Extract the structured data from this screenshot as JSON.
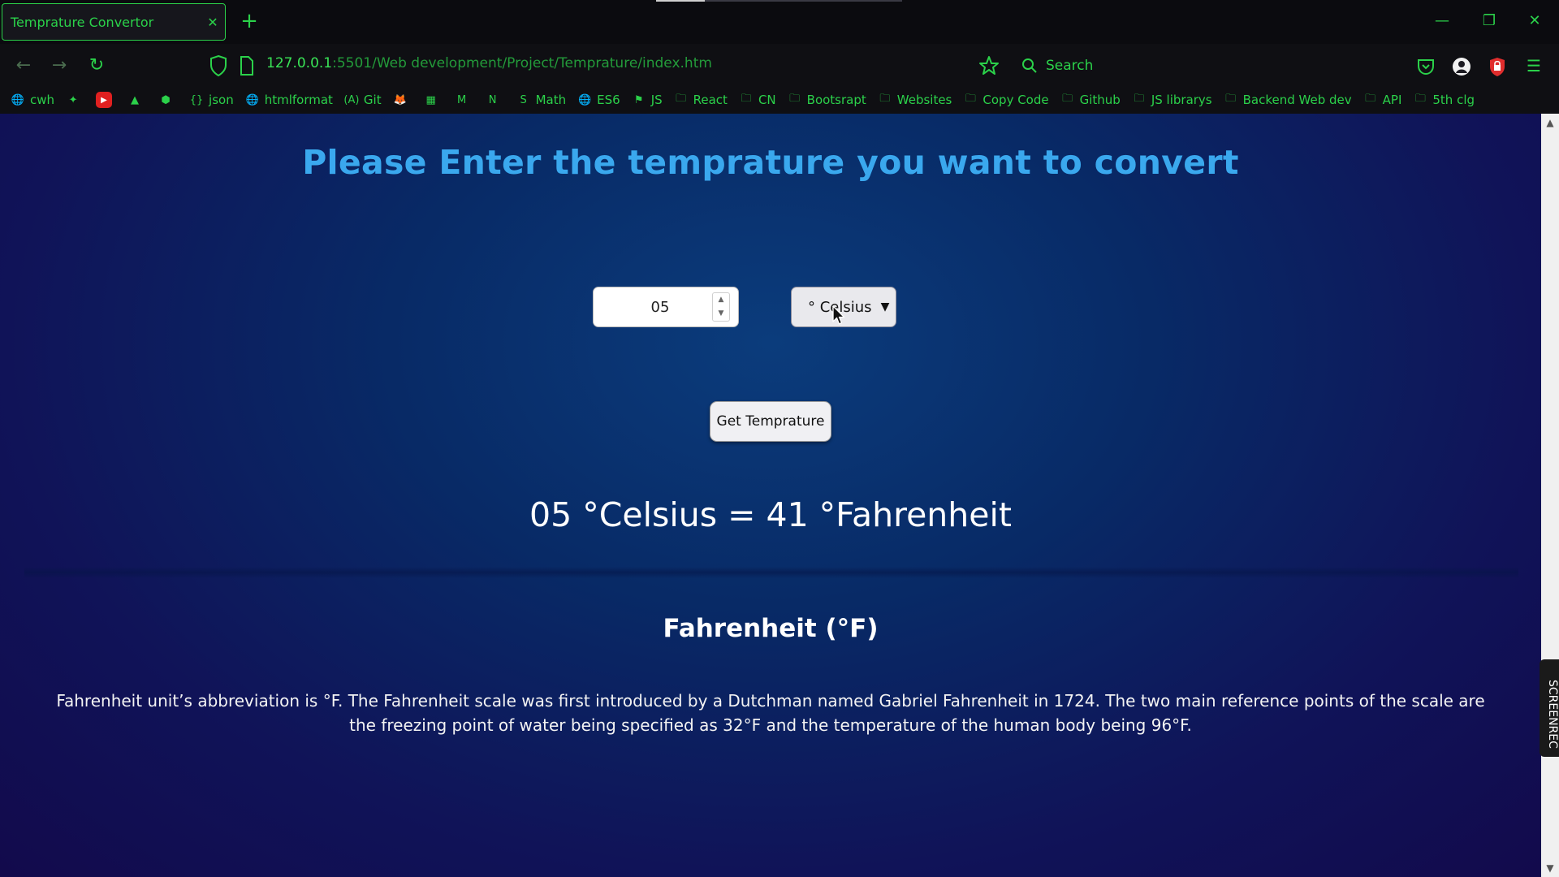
{
  "browser": {
    "tab_title": "Temprature Convertor",
    "tab_close": "✕",
    "new_tab": "+",
    "url_host": "127.0.0.1",
    "url_rest": ":5501/Web development/Project/Temprature/index.htm",
    "search_label": "Search",
    "window_controls": {
      "minimize": "—",
      "restore": "❐",
      "close": "✕"
    },
    "nav": {
      "back": "←",
      "forward": "→",
      "reload": "↻"
    },
    "bookmarks": [
      {
        "label": "cwh",
        "icon": "globe-icon"
      },
      {
        "label": "",
        "icon": "figma-icon"
      },
      {
        "label": "",
        "icon": "youtube-icon"
      },
      {
        "label": "",
        "icon": "drive-icon"
      },
      {
        "label": "",
        "icon": "hex-icon"
      },
      {
        "label": "json",
        "icon": "json-icon"
      },
      {
        "label": "htmlformat",
        "icon": "globe-icon"
      },
      {
        "label": "Git",
        "icon": "git-icon"
      },
      {
        "label": "",
        "icon": "fox-icon"
      },
      {
        "label": "",
        "icon": "grid-icon"
      },
      {
        "label": "",
        "icon": "mui-icon"
      },
      {
        "label": "",
        "icon": "notion-icon"
      },
      {
        "label": "Math",
        "icon": "s-icon"
      },
      {
        "label": "ES6",
        "icon": "globe-icon"
      },
      {
        "label": "JS",
        "icon": "js-icon"
      },
      {
        "label": "React",
        "icon": "folder-icon"
      },
      {
        "label": "CN",
        "icon": "folder-icon"
      },
      {
        "label": "Bootsrapt",
        "icon": "folder-icon"
      },
      {
        "label": "Websites",
        "icon": "folder-icon"
      },
      {
        "label": "Copy Code",
        "icon": "folder-icon"
      },
      {
        "label": "Github",
        "icon": "folder-icon"
      },
      {
        "label": "JS librarys",
        "icon": "folder-icon"
      },
      {
        "label": "Backend Web dev",
        "icon": "folder-icon"
      },
      {
        "label": "API",
        "icon": "folder-icon"
      },
      {
        "label": "5th clg",
        "icon": "folder-icon"
      }
    ]
  },
  "page": {
    "heading": "Please Enter the temprature you want to convert",
    "input_value": "05",
    "unit_selected": "° Celsius",
    "button_label": "Get Temprature",
    "result": "05 °Celsius = 41 °Fahrenheit",
    "unit_title": "Fahrenheit (°F)",
    "description": "Fahrenheit unit’s abbreviation is °F. The Fahrenheit scale was first introduced by a Dutchman named Gabriel Fahrenheit in 1724. The two main reference points of the scale are the freezing point of water being specified as 32°F and the temperature of the human body being 96°F."
  },
  "screenrec_label": "SCREENREC",
  "colors": {
    "chrome_accent": "#2bd14a",
    "heading": "#3aa8ee",
    "page_bg": "#082a66"
  }
}
